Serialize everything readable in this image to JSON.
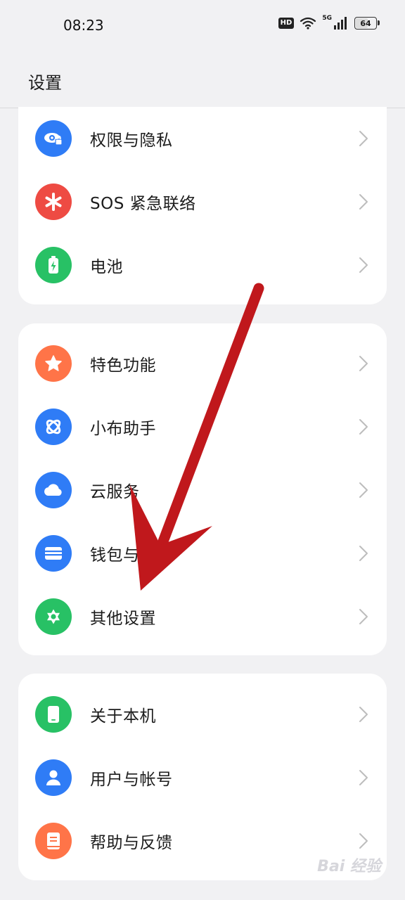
{
  "status_bar": {
    "time": "08:23",
    "hd": "HD",
    "network": "5G",
    "battery": "64",
    "battery_level_percent": 64
  },
  "header": {
    "title": "设置"
  },
  "groups": [
    {
      "items": [
        {
          "label": "权限与隐私",
          "icon": "privacy-eye-icon",
          "color": "#2f7cf6"
        },
        {
          "label": "SOS 紧急联络",
          "icon": "sos-asterisk-icon",
          "color": "#ee4b43"
        },
        {
          "label": "电池",
          "icon": "battery-icon",
          "color": "#28c165"
        }
      ]
    },
    {
      "items": [
        {
          "label": "特色功能",
          "icon": "star-icon",
          "color": "#ff7448"
        },
        {
          "label": "小布助手",
          "icon": "assistant-orbit-icon",
          "color": "#2f7cf6"
        },
        {
          "label": "云服务",
          "icon": "cloud-icon",
          "color": "#2f7cf6"
        },
        {
          "label": "钱包与支付",
          "icon": "wallet-icon",
          "color": "#2f7cf6"
        },
        {
          "label": "其他设置",
          "icon": "gear-icon",
          "color": "#28c165"
        }
      ]
    },
    {
      "items": [
        {
          "label": "关于本机",
          "icon": "phone-icon",
          "color": "#28c165"
        },
        {
          "label": "用户与帐号",
          "icon": "user-icon",
          "color": "#2f7cf6"
        },
        {
          "label": "帮助与反馈",
          "icon": "help-book-icon",
          "color": "#ff7448"
        }
      ]
    }
  ],
  "overlay": {
    "arrow_color": "#c0181c"
  },
  "watermark": {
    "text": "Bai 经验"
  }
}
